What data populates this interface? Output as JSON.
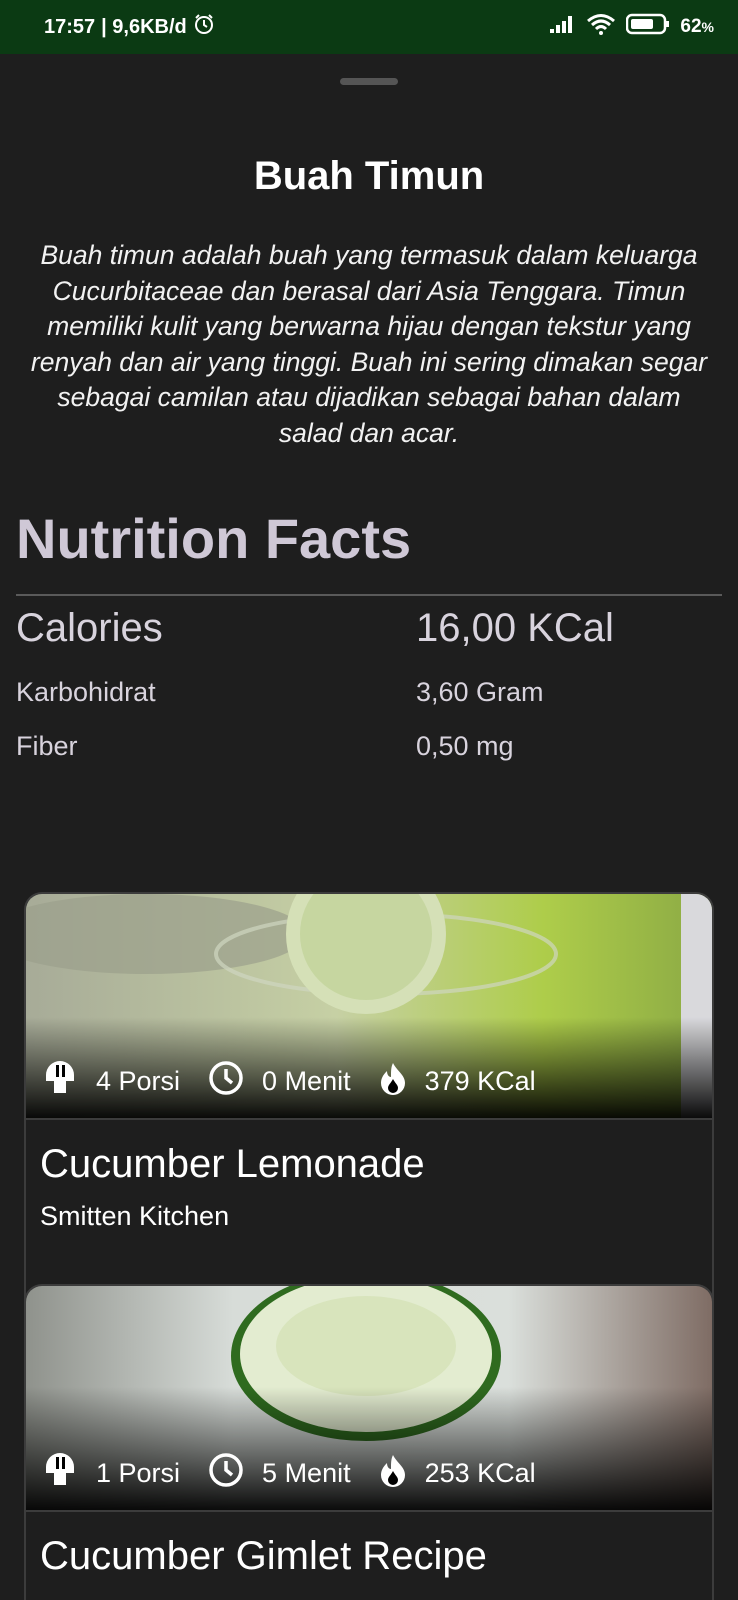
{
  "status_bar": {
    "time": "17:57",
    "network_speed": "| 9,6KB/d",
    "battery": "62",
    "battery_unit": "%",
    "icons": [
      "alarm-icon",
      "signal-icon",
      "wifi-icon",
      "battery-icon"
    ]
  },
  "detail": {
    "title": "Buah Timun",
    "description": "Buah timun adalah buah yang termasuk dalam keluarga Cucurbitaceae dan berasal dari Asia Tenggara. Timun memiliki kulit yang berwarna hijau dengan tekstur yang renyah dan air yang tinggi. Buah ini sering dimakan segar sebagai camilan atau dijadikan sebagai bahan dalam salad dan acar."
  },
  "nutrition": {
    "heading": "Nutrition Facts",
    "rows": [
      {
        "label": "Calories",
        "value": "16,00 KCal"
      },
      {
        "label": "Karbohidrat",
        "value": "3,60 Gram"
      },
      {
        "label": "Fiber",
        "value": "0,50 mg"
      }
    ]
  },
  "recipes": [
    {
      "title": "Cucumber Lemonade",
      "source": "Smitten Kitchen",
      "servings": "4 Porsi",
      "time": "0 Menit",
      "calories": "379 KCal",
      "icons": [
        "servings-icon",
        "clock-icon",
        "flame-icon"
      ]
    },
    {
      "title": "Cucumber Gimlet Recipe",
      "source": "",
      "servings": "1 Porsi",
      "time": "5 Menit",
      "calories": "253 KCal",
      "icons": [
        "servings-icon",
        "clock-icon",
        "flame-icon"
      ]
    }
  ],
  "colors": {
    "status_bar_bg": "#0b3a13",
    "sheet_bg": "#1e1e1e",
    "heading": "#cfc8d6",
    "card_border": "#3c3c3c"
  }
}
